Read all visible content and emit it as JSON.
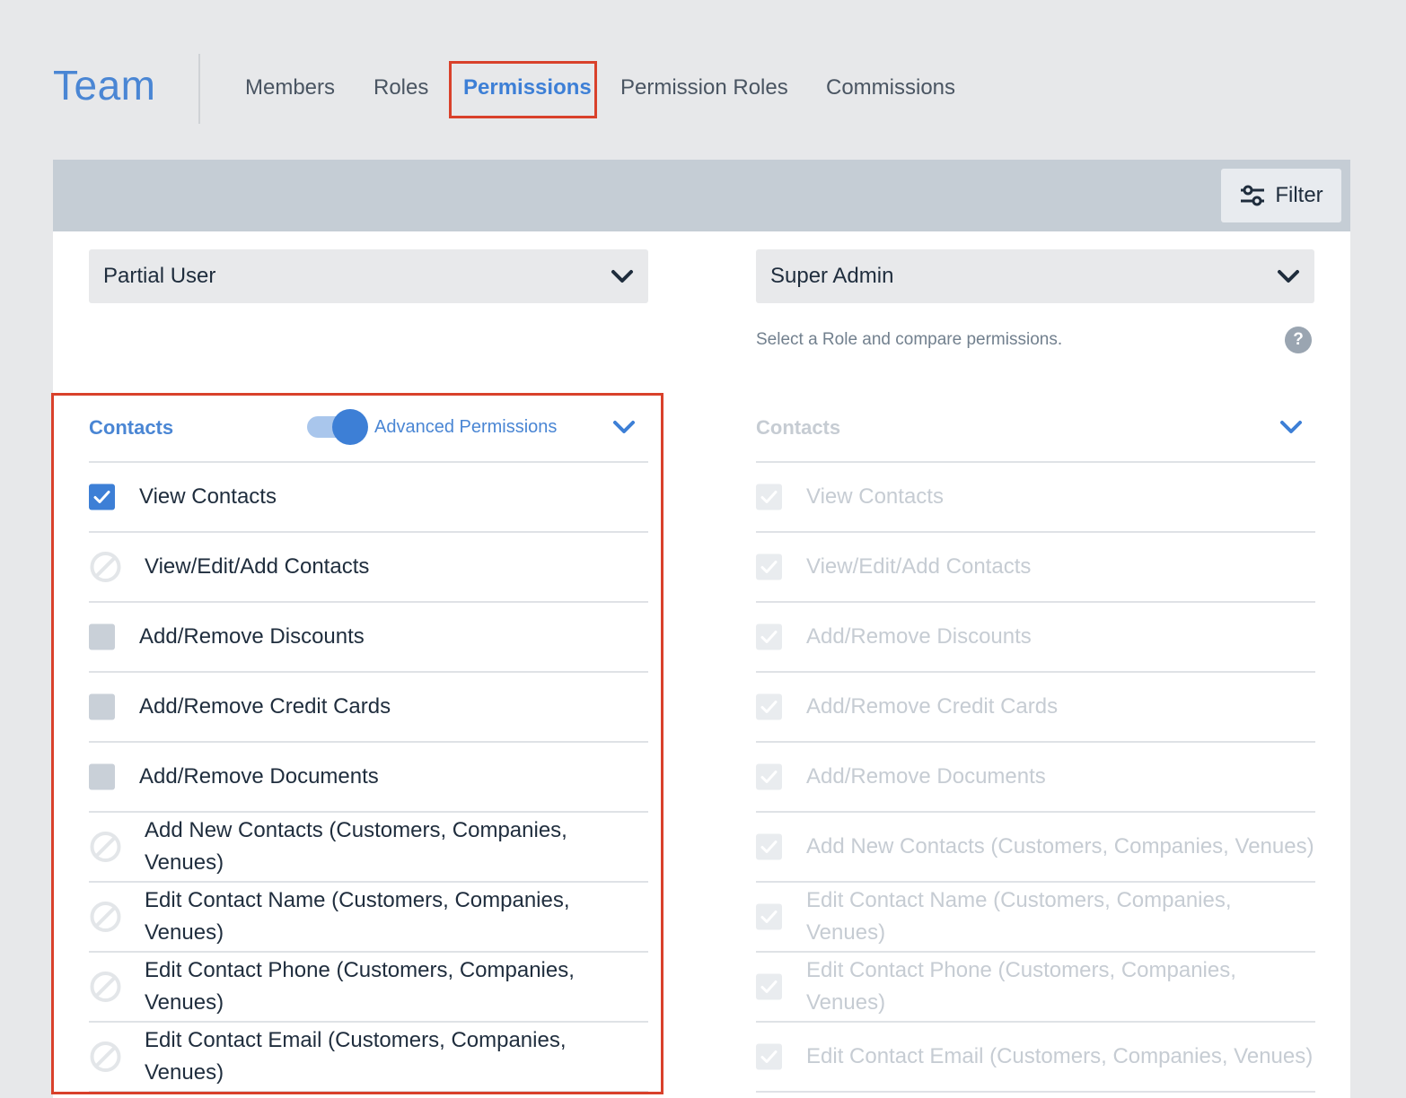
{
  "header": {
    "title": "Team",
    "tabs": [
      "Members",
      "Roles",
      "Permissions",
      "Permission Roles",
      "Commissions"
    ],
    "active_tab": "Permissions"
  },
  "toolbar": {
    "filter_label": "Filter"
  },
  "compare": {
    "left_role": "Partial User",
    "right_role": "Super Admin",
    "hint": "Select a Role and compare permissions.",
    "help_symbol": "?"
  },
  "section": {
    "title": "Contacts",
    "advanced_label": "Advanced Permissions",
    "advanced_enabled": true
  },
  "permissions": [
    {
      "label": "View Contacts",
      "left_state": "checked",
      "right_state": "checked"
    },
    {
      "label": "View/Edit/Add Contacts",
      "left_state": "blocked",
      "right_state": "checked"
    },
    {
      "label": "Add/Remove Discounts",
      "left_state": "unchecked",
      "right_state": "checked"
    },
    {
      "label": "Add/Remove Credit Cards",
      "left_state": "unchecked",
      "right_state": "checked"
    },
    {
      "label": "Add/Remove Documents",
      "left_state": "unchecked",
      "right_state": "checked"
    },
    {
      "label": "Add New Contacts (Customers, Companies, Venues)",
      "left_state": "blocked",
      "right_state": "checked"
    },
    {
      "label": "Edit Contact Name (Customers, Companies, Venues)",
      "left_state": "blocked",
      "right_state": "checked"
    },
    {
      "label": "Edit Contact Phone (Customers, Companies, Venues)",
      "left_state": "blocked",
      "right_state": "checked"
    },
    {
      "label": "Edit Contact Email (Customers, Companies, Venues)",
      "left_state": "blocked",
      "right_state": "checked"
    }
  ],
  "colors": {
    "accent": "#3d7fd6",
    "highlight": "#d9412b",
    "muted_text": "#c6ccd3"
  }
}
